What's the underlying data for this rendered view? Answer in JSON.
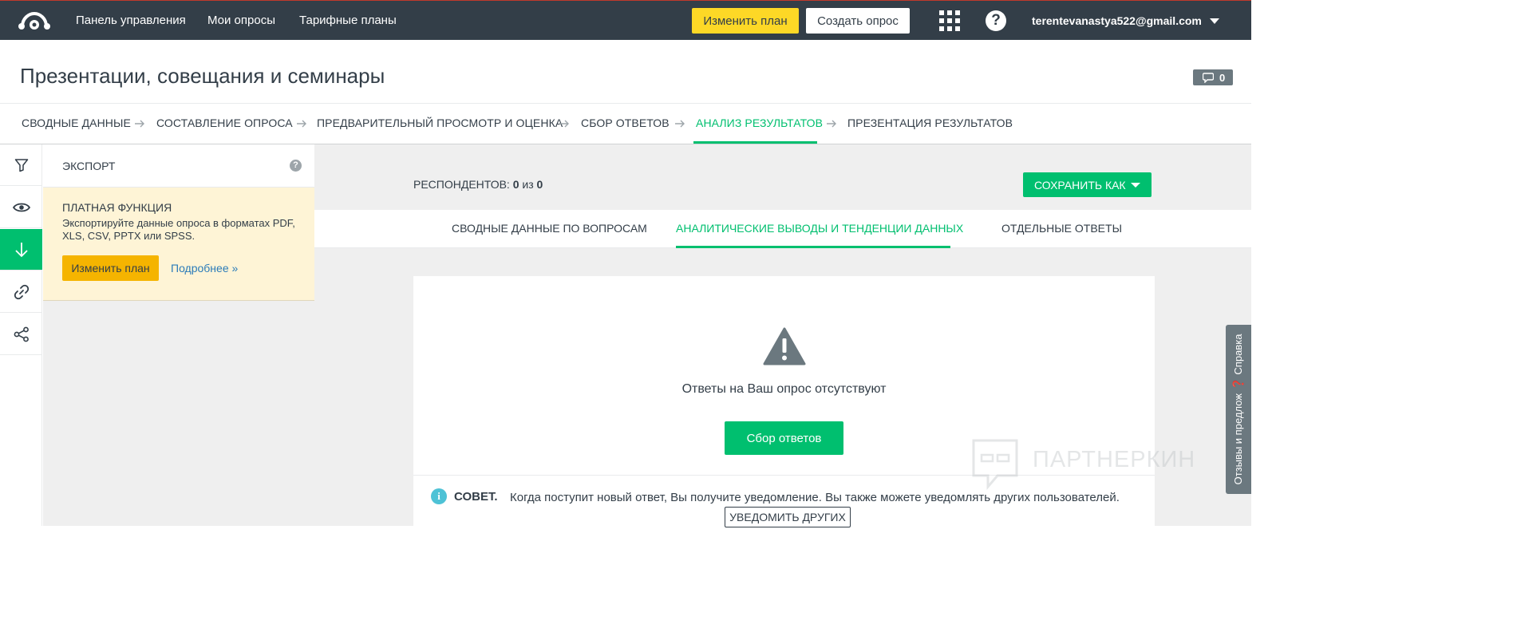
{
  "topnav": {
    "links": [
      "Панель управления",
      "Мои опросы",
      "Тарифные планы"
    ],
    "upgrade_label": "Изменить план",
    "create_label": "Создать опрос",
    "account": "terentevanastya522@gmail.com",
    "help_glyph": "?",
    "icons": [
      "monkey-logo",
      "apps-grid-icon",
      "help-icon",
      "chevron-down-icon"
    ]
  },
  "page": {
    "title": "Презентации, совещания и семинары",
    "comments_count": "0"
  },
  "steps": {
    "items": [
      "СВОДНЫЕ ДАННЫЕ",
      "СОСТАВЛЕНИЕ ОПРОСА",
      "ПРЕДВАРИТЕЛЬНЫЙ ПРОСМОТР И ОЦЕНКА",
      "СБОР ОТВЕТОВ",
      "АНАЛИЗ РЕЗУЛЬТАТОВ",
      "ПРЕЗЕНТАЦИЯ РЕЗУЛЬТАТОВ"
    ],
    "active_index": 4
  },
  "iconbar": {
    "icons": [
      "filter-icon",
      "eye-icon",
      "download-icon",
      "link-icon",
      "share-icon"
    ],
    "active_index": 2
  },
  "sidepanel": {
    "title": "ЭКСПОРТ",
    "help_glyph": "?",
    "paid_heading": "ПЛАТНАЯ ФУНКЦИЯ",
    "paid_desc": "Экспортируйте данные опроса в форматах PDF, XLS, CSV, PPTX или SPSS.",
    "upgrade_label": "Изменить план",
    "more_link": "Подробнее »"
  },
  "main": {
    "respondents_label": "РЕСПОНДЕНТОВ:",
    "respondents_count": "0",
    "respondents_of": "из",
    "respondents_total": "0",
    "save_as_label": "СОХРАНИТЬ КАК",
    "tabs": [
      "СВОДНЫЕ ДАННЫЕ ПО ВОПРОСАМ",
      "АНАЛИТИЧЕСКИЕ ВЫВОДЫ И ТЕНДЕНЦИИ ДАННЫХ",
      "ОТДЕЛЬНЫЕ ОТВЕТЫ"
    ],
    "active_tab": 1,
    "empty_message": "Ответы на Ваш опрос отсутствуют",
    "collect_label": "Сбор ответов",
    "tip_label": "СОВЕТ.",
    "tip_text": "Когда поступит новый ответ, Вы получите уведомление. Вы также можете уведомлять других пользователей.",
    "notify_label": "УВЕДОМИТЬ ДРУГИХ"
  },
  "watermark": {
    "text": "ПАРТНЕРКИН"
  },
  "feedback": {
    "label": "Отзывы и предлож",
    "help_label": "Справка"
  },
  "colors": {
    "nav_bg": "#333e48",
    "accent_green": "#00bf6f",
    "upgrade_yellow": "#fdd826",
    "paid_bg": "#fef4d6",
    "link_blue": "#2b7bb9"
  }
}
